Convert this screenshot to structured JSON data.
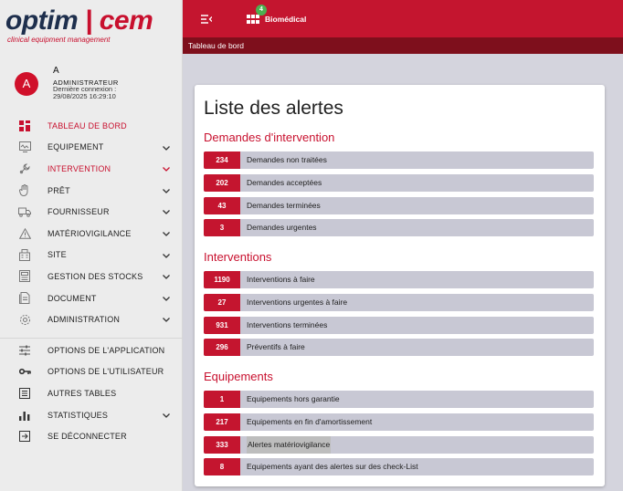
{
  "logo": {
    "part1": "optim",
    "separator": "|",
    "part2": "cem",
    "tagline": "clinical equipment management"
  },
  "user": {
    "initial": "A",
    "name": "A",
    "role": "ADMINISTRATEUR",
    "last_login_label": "Dernière connexion :",
    "last_login_value": "29/08/2025 16:29:10"
  },
  "menu": [
    {
      "label": "TABLEAU DE BORD",
      "icon": "dashboard-icon",
      "active": true,
      "has_chevron": false
    },
    {
      "label": "EQUIPEMENT",
      "icon": "equipment-icon",
      "has_chevron": true
    },
    {
      "label": "INTERVENTION",
      "icon": "intervention-icon",
      "has_chevron": true,
      "active_chevron": true
    },
    {
      "label": "PRÊT",
      "icon": "hand-icon",
      "has_chevron": true
    },
    {
      "label": "FOURNISSEUR",
      "icon": "truck-icon",
      "has_chevron": true
    },
    {
      "label": "MATÉRIOVIGILANCE",
      "icon": "warning-icon",
      "has_chevron": true
    },
    {
      "label": "SITE",
      "icon": "building-icon",
      "has_chevron": true
    },
    {
      "label": "GESTION DES STOCKS",
      "icon": "stock-icon",
      "has_chevron": true
    },
    {
      "label": "DOCUMENT",
      "icon": "document-icon",
      "has_chevron": true
    },
    {
      "label": "ADMINISTRATION",
      "icon": "gear-icon",
      "has_chevron": true
    }
  ],
  "menu_bottom": [
    {
      "label": "OPTIONS DE L'APPLICATION",
      "icon": "sliders-icon",
      "has_chevron": false
    },
    {
      "label": "OPTIONS DE L'UTILISATEUR",
      "icon": "key-icon",
      "has_chevron": false
    },
    {
      "label": "AUTRES TABLES",
      "icon": "table-icon",
      "has_chevron": false
    },
    {
      "label": "STATISTIQUES",
      "icon": "bar-chart-icon",
      "has_chevron": true
    },
    {
      "label": "SE DÉCONNECTER",
      "icon": "logout-icon",
      "has_chevron": false
    }
  ],
  "topbar": {
    "module_label": "Biomédical",
    "module_badge": "4"
  },
  "breadcrumb": "Tableau de bord",
  "page_title": "Liste des alertes",
  "sections": [
    {
      "title": "Demandes d'intervention",
      "alerts": [
        {
          "count": "234",
          "label": "Demandes non traitées"
        },
        {
          "count": "202",
          "label": "Demandes acceptées"
        },
        {
          "count": "43",
          "label": "Demandes terminées"
        },
        {
          "count": "3",
          "label": "Demandes urgentes"
        }
      ]
    },
    {
      "title": "Interventions",
      "alerts": [
        {
          "count": "1190",
          "label": "Interventions à faire"
        },
        {
          "count": "27",
          "label": "Interventions urgentes à faire"
        },
        {
          "count": "931",
          "label": "Interventions terminées"
        },
        {
          "count": "296",
          "label": "Préventifs à faire"
        }
      ]
    },
    {
      "title": "Equipements",
      "alerts": [
        {
          "count": "1",
          "label": "Equipements hors garantie"
        },
        {
          "count": "217",
          "label": "Equipements en fin d'amortissement"
        },
        {
          "count": "333",
          "label": "Alertes matériovigilance",
          "highlight": true
        },
        {
          "count": "8",
          "label": "Equipements ayant des alertes sur des check-List"
        }
      ]
    }
  ],
  "colors": {
    "brand_red": "#c4152f",
    "brand_dark": "#1e2f4d",
    "breadcrumb_bg": "#7e0f1c",
    "badge_green": "#4caf50"
  }
}
